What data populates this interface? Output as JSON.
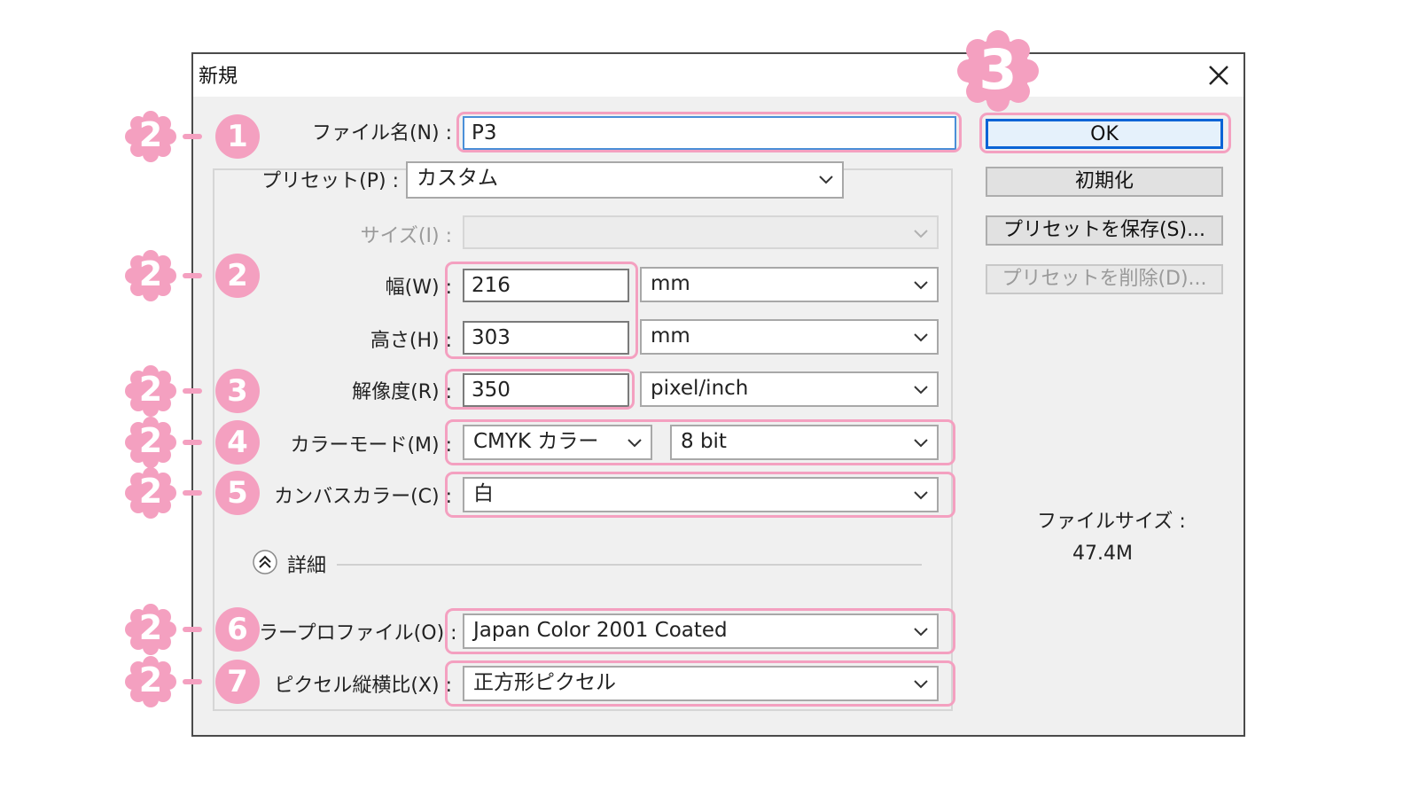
{
  "dialog": {
    "title": "新規",
    "close_icon": "close-icon"
  },
  "form": {
    "filename": {
      "label": "ファイル名(N) :",
      "value": "P3"
    },
    "preset": {
      "label": "プリセット(P) :",
      "value": "カスタム"
    },
    "size": {
      "label": "サイズ(I) :",
      "value": ""
    },
    "width": {
      "label": "幅(W) :",
      "value": "216",
      "unit": "mm"
    },
    "height": {
      "label": "高さ(H) :",
      "value": "303",
      "unit": "mm"
    },
    "resolution": {
      "label": "解像度(R) :",
      "value": "350",
      "unit": "pixel/inch"
    },
    "color_mode": {
      "label": "カラーモード(M) :",
      "mode": "CMYK カラー",
      "bit": "8 bit"
    },
    "canvas_color": {
      "label": "カンバスカラー(C) :",
      "value": "白"
    },
    "details": {
      "label": "詳細"
    },
    "color_profile": {
      "label": "カラープロファイル(O) :",
      "value": "Japan Color 2001 Coated"
    },
    "pixel_aspect": {
      "label": "ピクセル縦横比(X) :",
      "value": "正方形ピクセル"
    }
  },
  "buttons": {
    "ok": "OK",
    "reset": "初期化",
    "save_preset": "プリセットを保存(S)...",
    "delete_preset": "プリセットを削除(D)..."
  },
  "filesize": {
    "label": "ファイルサイズ :",
    "value": "47.4M"
  },
  "annotations": {
    "main_step": "2",
    "ok_step": "3",
    "sub_steps": [
      "1",
      "2",
      "3",
      "4",
      "5",
      "6",
      "7"
    ],
    "color": "#f4a0c0"
  }
}
